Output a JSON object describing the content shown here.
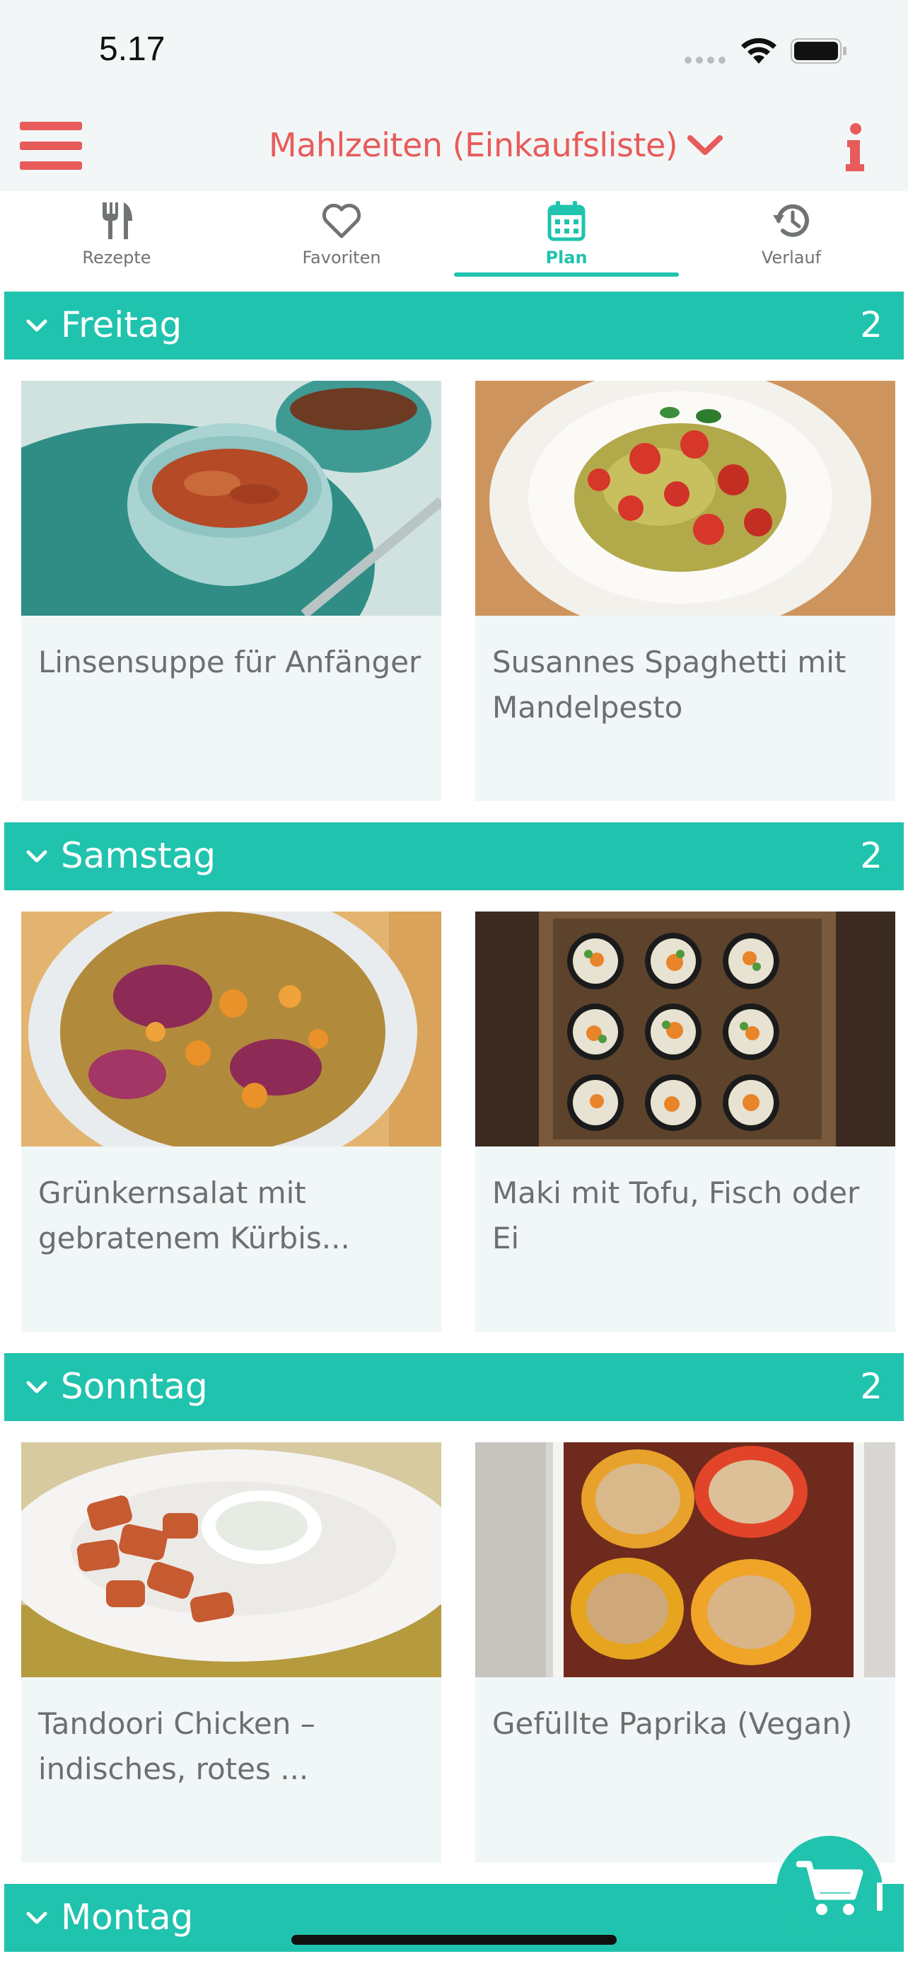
{
  "status_bar": {
    "time": "5.17"
  },
  "header": {
    "title": "Mahlzeiten (Einkaufsliste)"
  },
  "tabs": [
    {
      "label": "Rezepte",
      "icon": "fork-knife-icon"
    },
    {
      "label": "Favoriten",
      "icon": "heart-icon"
    },
    {
      "label": "Plan",
      "icon": "calendar-icon",
      "active": true
    },
    {
      "label": "Verlauf",
      "icon": "history-icon"
    }
  ],
  "colors": {
    "accent": "#20c3ad",
    "brand": "#e85b5b",
    "card_bg": "#f1f6f6"
  },
  "days": [
    {
      "title": "Freitag",
      "count": "2",
      "meals": [
        {
          "title": "Linsensuppe für Anfänger"
        },
        {
          "title": "Susannes Spaghetti mit Mandelpesto"
        }
      ]
    },
    {
      "title": "Samstag",
      "count": "2",
      "meals": [
        {
          "title": "Grünkernsalat mit gebratenem Kürbis..."
        },
        {
          "title": "Maki mit Tofu, Fisch oder Ei"
        }
      ]
    },
    {
      "title": "Sonntag",
      "count": "2",
      "meals": [
        {
          "title": "Tandoori Chicken –indisches, rotes ..."
        },
        {
          "title": "Gefüllte Paprika (Vegan)"
        }
      ]
    },
    {
      "title": "Montag",
      "count": ""
    }
  ]
}
